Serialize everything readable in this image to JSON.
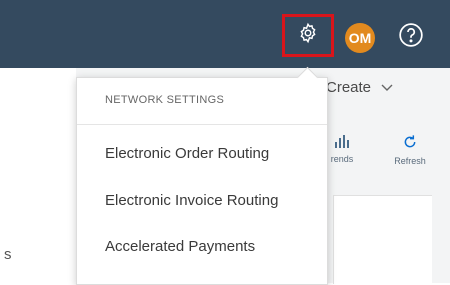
{
  "header": {
    "avatar_initials": "OM",
    "icons": {
      "settings": "gear-icon",
      "help": "help-icon"
    }
  },
  "subbar": {
    "create_label": "Create",
    "tiles": [
      {
        "label": "rends",
        "icon": "bar-chart-icon"
      },
      {
        "label": "Refresh",
        "icon": "refresh-icon"
      }
    ],
    "left_text": "s"
  },
  "menu": {
    "header": "NETWORK SETTINGS",
    "items": [
      {
        "label": "Electronic Order Routing"
      },
      {
        "label": "Electronic Invoice Routing"
      },
      {
        "label": "Accelerated Payments"
      }
    ]
  },
  "colors": {
    "header_bg": "#344a5f",
    "highlight_border": "#d9151b",
    "avatar_bg": "#e28a1e",
    "accent_blue": "#0a6ed1"
  }
}
